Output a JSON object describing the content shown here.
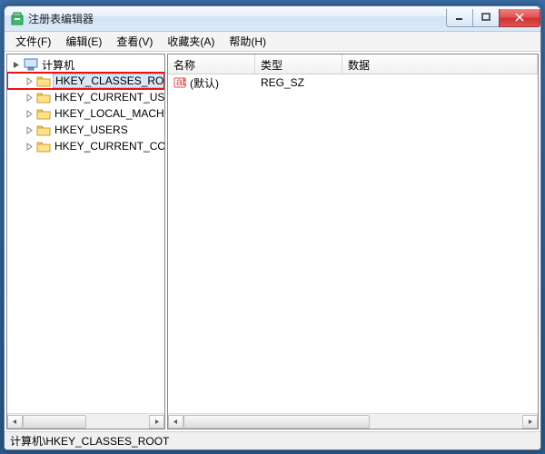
{
  "window": {
    "title": "注册表编辑器"
  },
  "menu": {
    "file": "文件(F)",
    "edit": "编辑(E)",
    "view": "查看(V)",
    "favorites": "收藏夹(A)",
    "help": "帮助(H)"
  },
  "tree": {
    "root": "计算机",
    "items": [
      {
        "label": "HKEY_CLASSES_ROOT",
        "highlighted": true
      },
      {
        "label": "HKEY_CURRENT_USER",
        "highlighted": false
      },
      {
        "label": "HKEY_LOCAL_MACHINE",
        "highlighted": false
      },
      {
        "label": "HKEY_USERS",
        "highlighted": false
      },
      {
        "label": "HKEY_CURRENT_CONFIG",
        "highlighted": false
      }
    ]
  },
  "list": {
    "columns": {
      "name": "名称",
      "type": "类型",
      "data": "数据"
    },
    "rows": [
      {
        "name": "(默认)",
        "type": "REG_SZ",
        "data": ""
      }
    ]
  },
  "statusbar": {
    "path": "计算机\\HKEY_CLASSES_ROOT"
  }
}
